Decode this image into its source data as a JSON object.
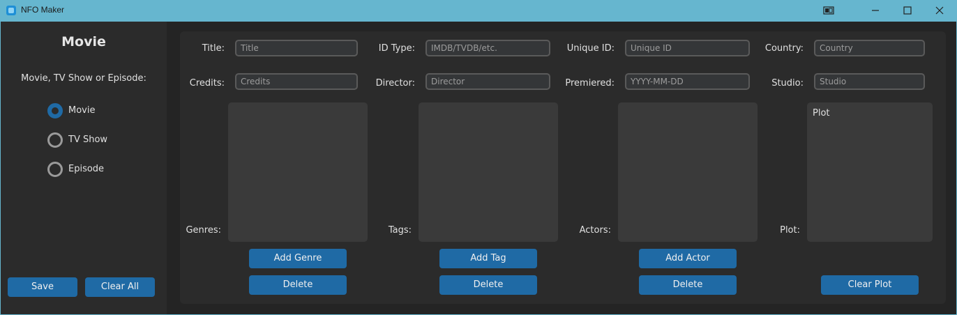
{
  "window": {
    "title": "NFO Maker"
  },
  "sidebar": {
    "heading": "Movie",
    "prompt": "Movie, TV Show or Episode:",
    "options": [
      {
        "label": "Movie",
        "selected": true
      },
      {
        "label": "TV Show",
        "selected": false
      },
      {
        "label": "Episode",
        "selected": false
      }
    ],
    "save_label": "Save",
    "clear_all_label": "Clear All"
  },
  "fields": {
    "title": {
      "label": "Title:",
      "placeholder": "Title"
    },
    "id_type": {
      "label": "ID Type:",
      "placeholder": "IMDB/TVDB/etc."
    },
    "unique_id": {
      "label": "Unique ID:",
      "placeholder": "Unique ID"
    },
    "country": {
      "label": "Country:",
      "placeholder": "Country"
    },
    "credits": {
      "label": "Credits:",
      "placeholder": "Credits"
    },
    "director": {
      "label": "Director:",
      "placeholder": "Director"
    },
    "premiered": {
      "label": "Premiered:",
      "placeholder": "YYYY-MM-DD"
    },
    "studio": {
      "label": "Studio:",
      "placeholder": "Studio"
    }
  },
  "lists": {
    "genres": {
      "label": "Genres:",
      "add_label": "Add Genre",
      "delete_label": "Delete"
    },
    "tags": {
      "label": "Tags:",
      "add_label": "Add Tag",
      "delete_label": "Delete"
    },
    "actors": {
      "label": "Actors:",
      "add_label": "Add Actor",
      "delete_label": "Delete"
    },
    "plot": {
      "label": "Plot:",
      "text": "Plot",
      "clear_label": "Clear Plot"
    }
  },
  "colors": {
    "accent": "#1f6aa5",
    "titlebar": "#66b6cf",
    "panel": "#2b2b2b",
    "background": "#242424"
  }
}
